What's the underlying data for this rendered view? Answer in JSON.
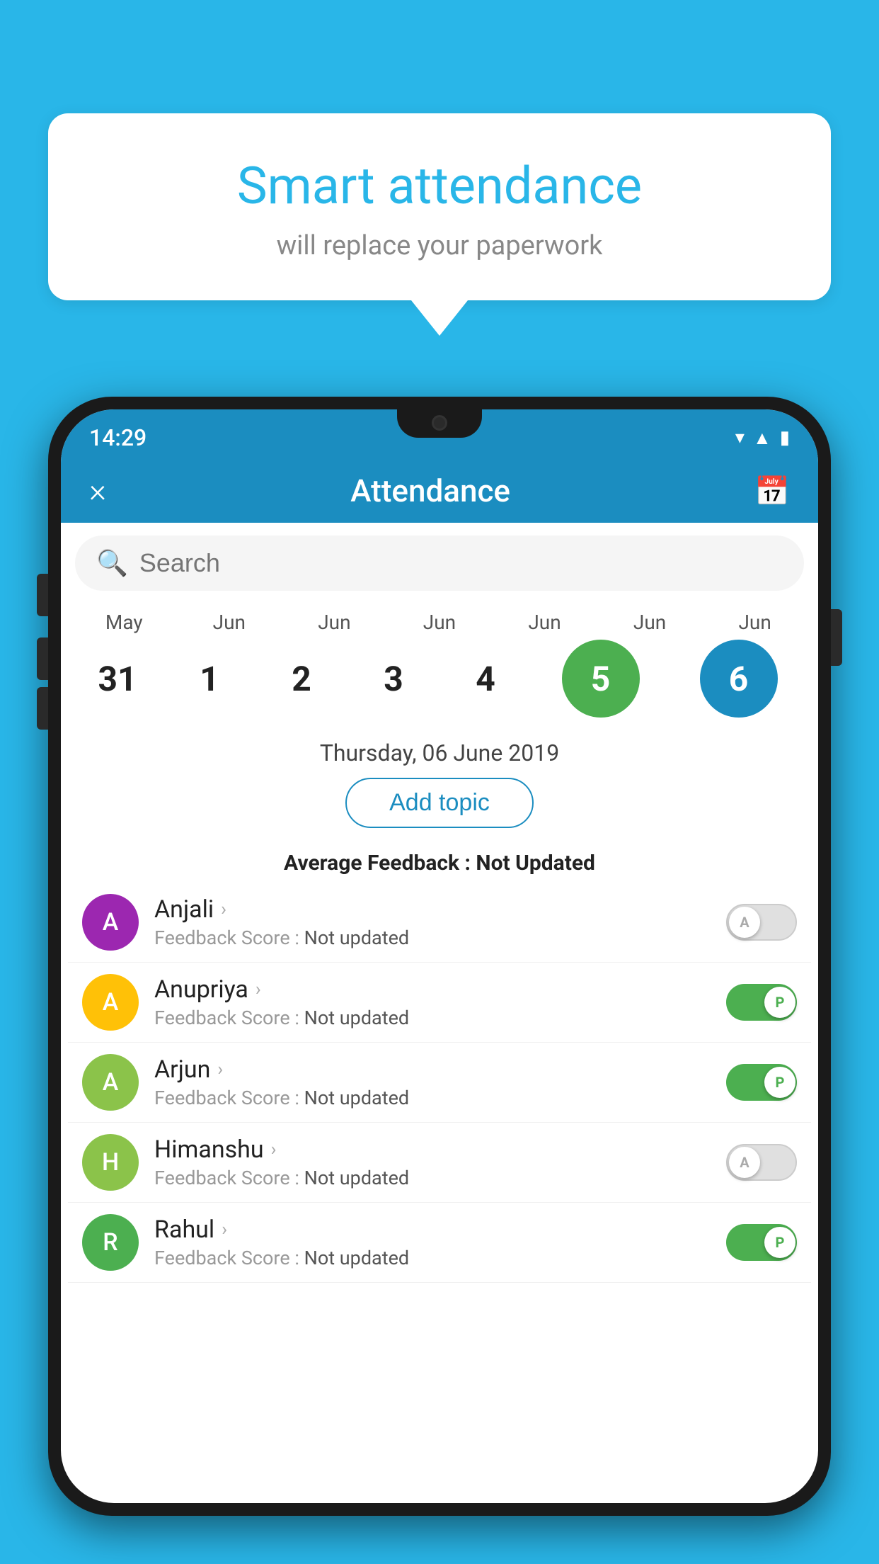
{
  "background_color": "#29B6E8",
  "speech_bubble": {
    "title": "Smart attendance",
    "subtitle": "will replace your paperwork"
  },
  "status_bar": {
    "time": "14:29",
    "icons": [
      "wifi",
      "signal",
      "battery"
    ]
  },
  "header": {
    "title": "Attendance",
    "close_label": "×",
    "calendar_icon": "📅"
  },
  "search": {
    "placeholder": "Search"
  },
  "calendar": {
    "months": [
      "May",
      "Jun",
      "Jun",
      "Jun",
      "Jun",
      "Jun",
      "Jun"
    ],
    "dates": [
      "31",
      "1",
      "2",
      "3",
      "4",
      "5",
      "6"
    ],
    "today_index": 5,
    "selected_index": 6
  },
  "selected_date_label": "Thursday, 06 June 2019",
  "add_topic_label": "Add topic",
  "average_feedback_label": "Average Feedback : ",
  "average_feedback_value": "Not Updated",
  "students": [
    {
      "name": "Anjali",
      "initial": "A",
      "avatar_color": "#9C27B0",
      "feedback_label": "Feedback Score : ",
      "feedback_value": "Not updated",
      "toggle_state": "off",
      "toggle_letter": "A"
    },
    {
      "name": "Anupriya",
      "initial": "A",
      "avatar_color": "#FFC107",
      "feedback_label": "Feedback Score : ",
      "feedback_value": "Not updated",
      "toggle_state": "on",
      "toggle_letter": "P"
    },
    {
      "name": "Arjun",
      "initial": "A",
      "avatar_color": "#8BC34A",
      "feedback_label": "Feedback Score : ",
      "feedback_value": "Not updated",
      "toggle_state": "on",
      "toggle_letter": "P"
    },
    {
      "name": "Himanshu",
      "initial": "H",
      "avatar_color": "#8BC34A",
      "feedback_label": "Feedback Score : ",
      "feedback_value": "Not updated",
      "toggle_state": "off",
      "toggle_letter": "A"
    },
    {
      "name": "Rahul",
      "initial": "R",
      "avatar_color": "#4CAF50",
      "feedback_label": "Feedback Score : ",
      "feedback_value": "Not updated",
      "toggle_state": "on",
      "toggle_letter": "P"
    }
  ]
}
